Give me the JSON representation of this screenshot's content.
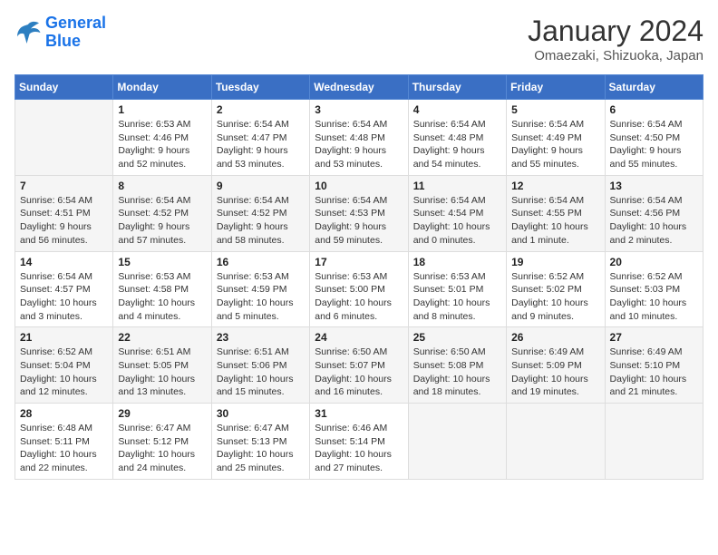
{
  "logo": {
    "line1": "General",
    "line2": "Blue"
  },
  "title": "January 2024",
  "location": "Omaezaki, Shizuoka, Japan",
  "days_of_week": [
    "Sunday",
    "Monday",
    "Tuesday",
    "Wednesday",
    "Thursday",
    "Friday",
    "Saturday"
  ],
  "weeks": [
    [
      {
        "day": "",
        "sunrise": "",
        "sunset": "",
        "daylight": ""
      },
      {
        "day": "1",
        "sunrise": "Sunrise: 6:53 AM",
        "sunset": "Sunset: 4:46 PM",
        "daylight": "Daylight: 9 hours and 52 minutes."
      },
      {
        "day": "2",
        "sunrise": "Sunrise: 6:54 AM",
        "sunset": "Sunset: 4:47 PM",
        "daylight": "Daylight: 9 hours and 53 minutes."
      },
      {
        "day": "3",
        "sunrise": "Sunrise: 6:54 AM",
        "sunset": "Sunset: 4:48 PM",
        "daylight": "Daylight: 9 hours and 53 minutes."
      },
      {
        "day": "4",
        "sunrise": "Sunrise: 6:54 AM",
        "sunset": "Sunset: 4:48 PM",
        "daylight": "Daylight: 9 hours and 54 minutes."
      },
      {
        "day": "5",
        "sunrise": "Sunrise: 6:54 AM",
        "sunset": "Sunset: 4:49 PM",
        "daylight": "Daylight: 9 hours and 55 minutes."
      },
      {
        "day": "6",
        "sunrise": "Sunrise: 6:54 AM",
        "sunset": "Sunset: 4:50 PM",
        "daylight": "Daylight: 9 hours and 55 minutes."
      }
    ],
    [
      {
        "day": "7",
        "sunrise": "Sunrise: 6:54 AM",
        "sunset": "Sunset: 4:51 PM",
        "daylight": "Daylight: 9 hours and 56 minutes."
      },
      {
        "day": "8",
        "sunrise": "Sunrise: 6:54 AM",
        "sunset": "Sunset: 4:52 PM",
        "daylight": "Daylight: 9 hours and 57 minutes."
      },
      {
        "day": "9",
        "sunrise": "Sunrise: 6:54 AM",
        "sunset": "Sunset: 4:52 PM",
        "daylight": "Daylight: 9 hours and 58 minutes."
      },
      {
        "day": "10",
        "sunrise": "Sunrise: 6:54 AM",
        "sunset": "Sunset: 4:53 PM",
        "daylight": "Daylight: 9 hours and 59 minutes."
      },
      {
        "day": "11",
        "sunrise": "Sunrise: 6:54 AM",
        "sunset": "Sunset: 4:54 PM",
        "daylight": "Daylight: 10 hours and 0 minutes."
      },
      {
        "day": "12",
        "sunrise": "Sunrise: 6:54 AM",
        "sunset": "Sunset: 4:55 PM",
        "daylight": "Daylight: 10 hours and 1 minute."
      },
      {
        "day": "13",
        "sunrise": "Sunrise: 6:54 AM",
        "sunset": "Sunset: 4:56 PM",
        "daylight": "Daylight: 10 hours and 2 minutes."
      }
    ],
    [
      {
        "day": "14",
        "sunrise": "Sunrise: 6:54 AM",
        "sunset": "Sunset: 4:57 PM",
        "daylight": "Daylight: 10 hours and 3 minutes."
      },
      {
        "day": "15",
        "sunrise": "Sunrise: 6:53 AM",
        "sunset": "Sunset: 4:58 PM",
        "daylight": "Daylight: 10 hours and 4 minutes."
      },
      {
        "day": "16",
        "sunrise": "Sunrise: 6:53 AM",
        "sunset": "Sunset: 4:59 PM",
        "daylight": "Daylight: 10 hours and 5 minutes."
      },
      {
        "day": "17",
        "sunrise": "Sunrise: 6:53 AM",
        "sunset": "Sunset: 5:00 PM",
        "daylight": "Daylight: 10 hours and 6 minutes."
      },
      {
        "day": "18",
        "sunrise": "Sunrise: 6:53 AM",
        "sunset": "Sunset: 5:01 PM",
        "daylight": "Daylight: 10 hours and 8 minutes."
      },
      {
        "day": "19",
        "sunrise": "Sunrise: 6:52 AM",
        "sunset": "Sunset: 5:02 PM",
        "daylight": "Daylight: 10 hours and 9 minutes."
      },
      {
        "day": "20",
        "sunrise": "Sunrise: 6:52 AM",
        "sunset": "Sunset: 5:03 PM",
        "daylight": "Daylight: 10 hours and 10 minutes."
      }
    ],
    [
      {
        "day": "21",
        "sunrise": "Sunrise: 6:52 AM",
        "sunset": "Sunset: 5:04 PM",
        "daylight": "Daylight: 10 hours and 12 minutes."
      },
      {
        "day": "22",
        "sunrise": "Sunrise: 6:51 AM",
        "sunset": "Sunset: 5:05 PM",
        "daylight": "Daylight: 10 hours and 13 minutes."
      },
      {
        "day": "23",
        "sunrise": "Sunrise: 6:51 AM",
        "sunset": "Sunset: 5:06 PM",
        "daylight": "Daylight: 10 hours and 15 minutes."
      },
      {
        "day": "24",
        "sunrise": "Sunrise: 6:50 AM",
        "sunset": "Sunset: 5:07 PM",
        "daylight": "Daylight: 10 hours and 16 minutes."
      },
      {
        "day": "25",
        "sunrise": "Sunrise: 6:50 AM",
        "sunset": "Sunset: 5:08 PM",
        "daylight": "Daylight: 10 hours and 18 minutes."
      },
      {
        "day": "26",
        "sunrise": "Sunrise: 6:49 AM",
        "sunset": "Sunset: 5:09 PM",
        "daylight": "Daylight: 10 hours and 19 minutes."
      },
      {
        "day": "27",
        "sunrise": "Sunrise: 6:49 AM",
        "sunset": "Sunset: 5:10 PM",
        "daylight": "Daylight: 10 hours and 21 minutes."
      }
    ],
    [
      {
        "day": "28",
        "sunrise": "Sunrise: 6:48 AM",
        "sunset": "Sunset: 5:11 PM",
        "daylight": "Daylight: 10 hours and 22 minutes."
      },
      {
        "day": "29",
        "sunrise": "Sunrise: 6:47 AM",
        "sunset": "Sunset: 5:12 PM",
        "daylight": "Daylight: 10 hours and 24 minutes."
      },
      {
        "day": "30",
        "sunrise": "Sunrise: 6:47 AM",
        "sunset": "Sunset: 5:13 PM",
        "daylight": "Daylight: 10 hours and 25 minutes."
      },
      {
        "day": "31",
        "sunrise": "Sunrise: 6:46 AM",
        "sunset": "Sunset: 5:14 PM",
        "daylight": "Daylight: 10 hours and 27 minutes."
      },
      {
        "day": "",
        "sunrise": "",
        "sunset": "",
        "daylight": ""
      },
      {
        "day": "",
        "sunrise": "",
        "sunset": "",
        "daylight": ""
      },
      {
        "day": "",
        "sunrise": "",
        "sunset": "",
        "daylight": ""
      }
    ]
  ]
}
